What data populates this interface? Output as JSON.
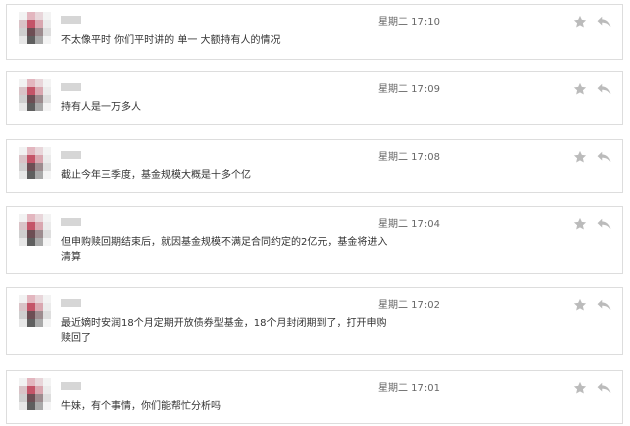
{
  "messages": [
    {
      "time": "星期二 17:10",
      "text": "不太像平时 你们平时讲的 单一 大额持有人的情况"
    },
    {
      "time": "星期二 17:09",
      "text": "持有人是一万多人"
    },
    {
      "time": "星期二 17:08",
      "text": "截止今年三季度，基金规模大概是十多个亿"
    },
    {
      "time": "星期二 17:04",
      "text": "但申购赎回期结束后，就因基金规模不满足合同约定的2亿元，基金将进入清算"
    },
    {
      "time": "星期二 17:02",
      "text": "最近嫡时安润18个月定期开放债券型基金，18个月封闭期到了，打开申购赎回了"
    },
    {
      "time": "星期二 17:01",
      "text": "牛妹，有个事情，你们能帮忙分析吗"
    }
  ],
  "icons": {
    "favorite": "star-icon",
    "reply": "reply-arrow-icon"
  },
  "colors": {
    "border": "#dddddd",
    "icon": "#bbbbbb",
    "text": "#333333",
    "time": "#666666"
  }
}
